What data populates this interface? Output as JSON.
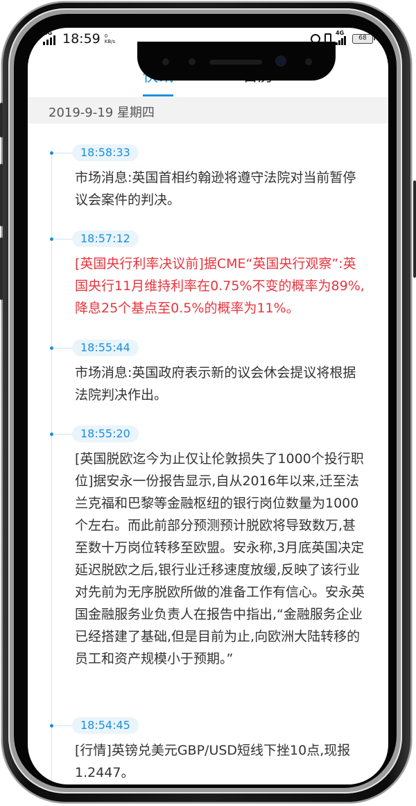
{
  "status_bar": {
    "network": "4G",
    "time": "18:59",
    "speed": "0 KB/s",
    "network_right": "4G",
    "battery": "68"
  },
  "tabs": [
    {
      "label": "快讯",
      "active": true
    },
    {
      "label": "日历",
      "active": false
    }
  ],
  "date_header": "2019-9-19  星期四",
  "accent_color": "#1a8fdc",
  "highlight_color": "#e8343d",
  "news": [
    {
      "time": "18:58:33",
      "text": "市场消息:英国首相约翰逊将遵守法院对当前暂停议会案件的判决。",
      "important": false
    },
    {
      "time": "18:57:12",
      "text": "[英国央行利率决议前]据CME“英国央行观察”:英国央行11月维持利率在0.75%不变的概率为89%,降息25个基点至0.5%的概率为11%。",
      "important": true
    },
    {
      "time": "18:55:44",
      "text": "市场消息:英国政府表示新的议会休会提议将根据法院判决作出。",
      "important": false
    },
    {
      "time": "18:55:20",
      "text": "[英国脱欧迄今为止仅让伦敦损失了1000个投行职位]据安永一份报告显示,自从2016年以来,迁至法兰克福和巴黎等金融枢纽的银行岗位数量为1000个左右。而此前部分预测预计脱欧将导致数万,甚至数十万岗位转移至欧盟。安永称,3月底英国决定延迟脱欧之后,银行业迁移速度放缓,反映了该行业对先前为无序脱欧所做的准备工作有信心。安永英国金融服务业负责人在报告中指出,“金融服务企业已经搭建了基础,但是目前为止,向欧洲大陆转移的员工和资产规模小于预期。”",
      "important": false
    },
    {
      "time": "18:54:45",
      "text": "[行情]英镑兑美元GBP/USD短线下挫10点,现报1.2447。",
      "important": false
    }
  ]
}
